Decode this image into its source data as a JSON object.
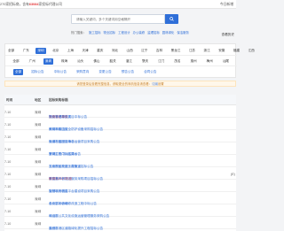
{
  "topbar": {
    "count_number": "270",
    "left_text_1": "家招标商，含有",
    "highlight_number": "63084",
    "left_text_2": "家投标代理公司",
    "right_text": "今日新增"
  },
  "search": {
    "placeholder": "请输入关键词，多个关键词用空格隔开"
  },
  "quick_links": {
    "label": "热门搜索：",
    "items": [
      "施工招标",
      "物业招标",
      "工程设计",
      "办公装修",
      "监理招标",
      "园林绿化",
      "保洁服务"
    ]
  },
  "top_right_link": "查看历史",
  "filters": {
    "regions": [
      "全部",
      "广东",
      "深圳",
      "北京",
      "上海",
      "天津",
      "重庆",
      "河北",
      "山西",
      "辽宁",
      "吉林",
      "黑龙江",
      "江苏",
      "浙江",
      "安徽",
      "福建",
      "江西"
    ],
    "cities": [
      "全部",
      "广州",
      "深圳",
      "珠海",
      "汕头",
      "佛山",
      "韶关",
      "湛江",
      "肇庆",
      "江门",
      "茂名",
      "惠州",
      "梅州",
      "汕尾"
    ],
    "types": [
      "全部",
      "招标公告",
      "中标公告",
      "采购意向",
      "变更公告",
      "预告公告",
      "合同公告"
    ],
    "active_region": 2,
    "active_city": 2,
    "active_type": 0
  },
  "notice": {
    "text": "请您登录后查看完整信息，获取更全的商机信息请查看：",
    "link": "订阅",
    "tail": "设置"
  },
  "table": {
    "headers": [
      "时间",
      "地区",
      "招标采购标题"
    ],
    "rows": [
      {
        "time": "7-10",
        "region": "深圳",
        "pre": "深圳市龙华区民",
        "red": "安街道办事处",
        "post": "物业管理服务项目中标公告",
        "tail": ""
      },
      {
        "time": "7-10",
        "region": "深圳",
        "pre": "深圳市南山区",
        "red": "",
        "post": "教育局校园安全防护设备采购招标公告",
        "tail": ""
      },
      {
        "time": "7-10",
        "region": "深圳",
        "pre": "深圳市福田区梅林",
        "red": "",
        "post": "街道社区服务中心运营项目采购公告",
        "tail": ""
      },
      {
        "time": "7-10",
        "region": "深圳",
        "pre": "罗湖区东门片区排水",
        "red": "",
        "post": "管网工程中标结果公告",
        "tail": ""
      },
      {
        "time": "7-10",
        "region": "深圳",
        "pre": "深圳市宝安区沙井街道",
        "red": "",
        "post": "工业园区改造工程施工招标公告",
        "tail": ""
      },
      {
        "time": "7-10",
        "region": "深圳",
        "pre": "深圳市",
        "red": "教育局2025年度",
        "post": "学生营养餐配送服务采购项目招标公告",
        "tail": "(E)"
      },
      {
        "time": "7-10",
        "region": "深圳",
        "pre": "深圳市光明区",
        "red": "",
        "post": "智慧城市信息平台建设项目采购公告",
        "tail": ""
      },
      {
        "time": "7-10",
        "region": "深圳",
        "pre": "龙岗区2025年",
        "red": "",
        "post": "中小学校舍维修改造工程中标公告",
        "tail": ""
      },
      {
        "time": "7-10",
        "region": "深圳",
        "pre": "深圳市",
        "red": "",
        "post": "坪山区公共文化设施运营管理服务采购公告",
        "tail": ""
      },
      {
        "time": "7-10",
        "region": "深圳",
        "pre": "深圳市",
        "red": "",
        "post": "盐田区港区道路绿化提升工程招标公告",
        "tail": ""
      }
    ]
  },
  "colors": {
    "primary": "#2f6fd8",
    "highlight": "#e4393c",
    "notice_bg": "#fff7ea",
    "notice_text": "#c6802a"
  }
}
